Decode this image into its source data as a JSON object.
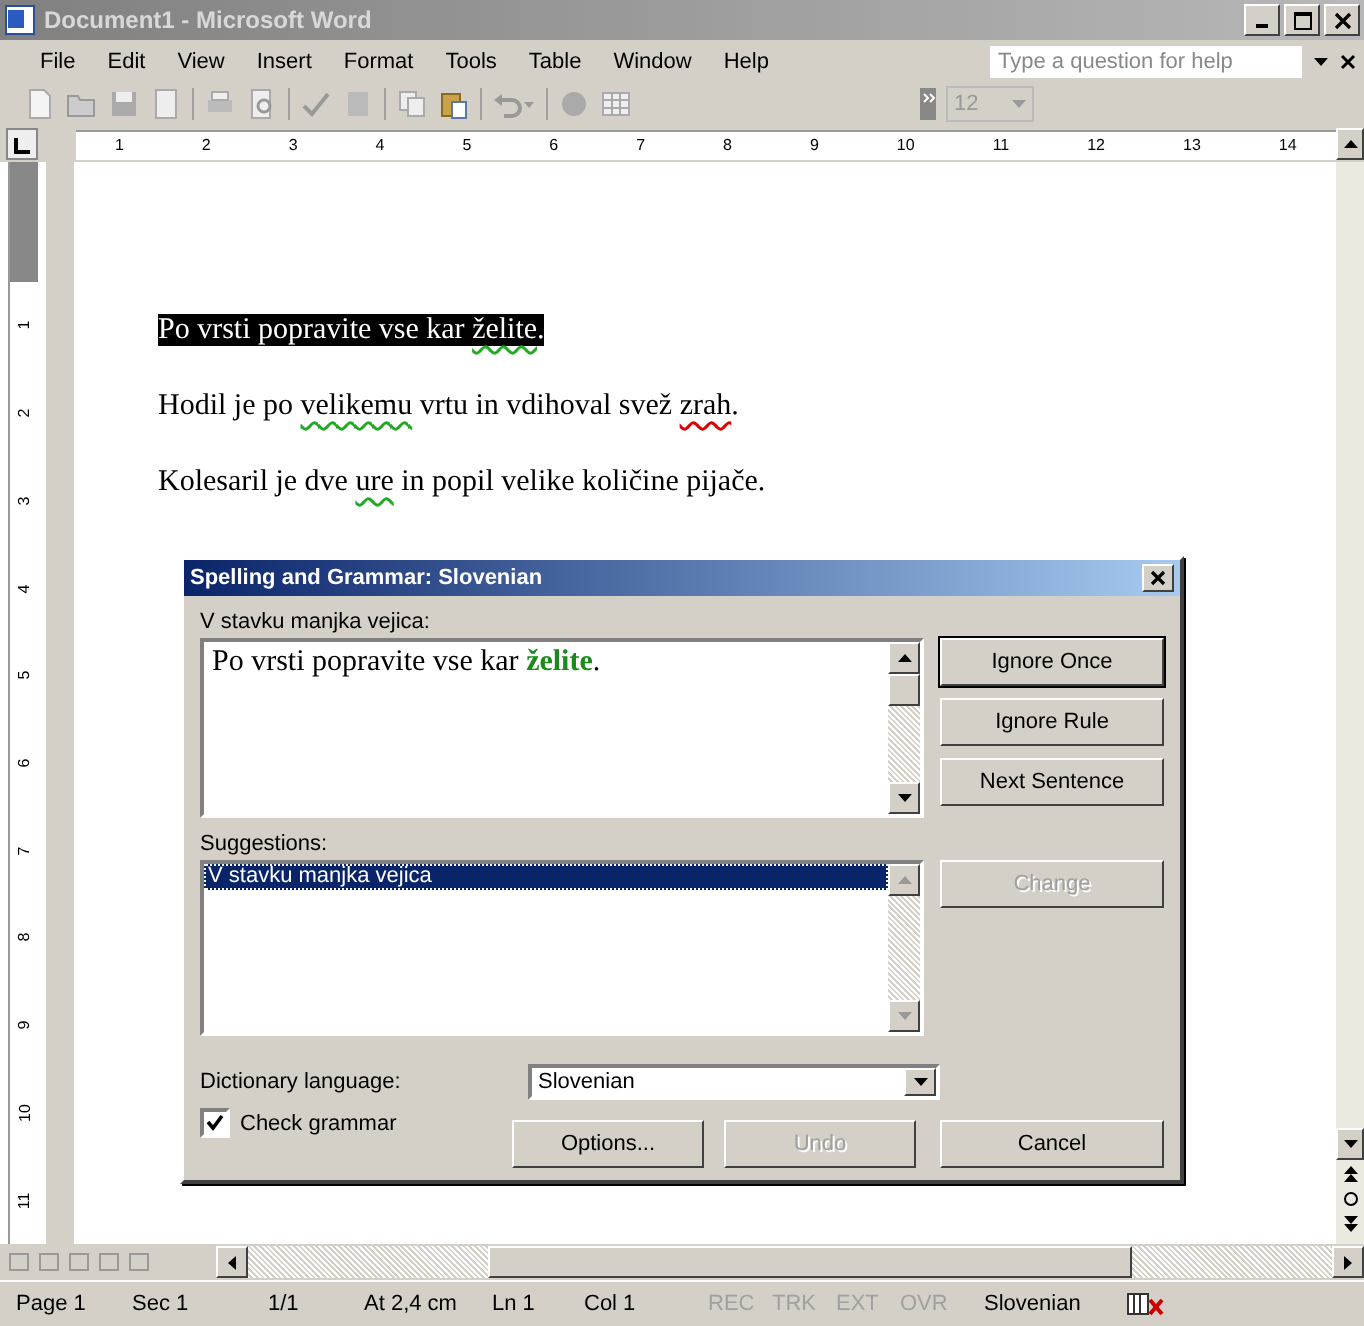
{
  "window": {
    "title": "Document1 - Microsoft Word",
    "active": false
  },
  "menu": [
    "File",
    "Edit",
    "View",
    "Insert",
    "Format",
    "Tools",
    "Table",
    "Window",
    "Help"
  ],
  "help_box": {
    "placeholder": "Type a question for help"
  },
  "toolbar": {
    "font_size": "12"
  },
  "ruler": {
    "marks": [
      "1",
      "2",
      "3",
      "4",
      "5",
      "6",
      "7",
      "8",
      "9",
      "10",
      "11",
      "12",
      "13",
      "14"
    ]
  },
  "vertical_ruler": {
    "marks": [
      "1",
      "2",
      "3",
      "4",
      "5",
      "6",
      "7",
      "8",
      "9",
      "10",
      "11"
    ]
  },
  "document": {
    "paragraphs": [
      {
        "selected": true,
        "segments": [
          {
            "text": "Po vrsti popravite vse kar ",
            "kind": "plain"
          },
          {
            "text": "želite",
            "kind": "grammar"
          },
          {
            "text": ".",
            "kind": "plain"
          }
        ]
      },
      {
        "selected": false,
        "segments": [
          {
            "text": "Hodil je po ",
            "kind": "plain"
          },
          {
            "text": "velikemu",
            "kind": "grammar"
          },
          {
            "text": " vrtu in vdihoval svež ",
            "kind": "plain"
          },
          {
            "text": "zrah",
            "kind": "spelling"
          },
          {
            "text": ".",
            "kind": "plain"
          }
        ]
      },
      {
        "selected": false,
        "segments": [
          {
            "text": "Kolesaril je dve ",
            "kind": "plain"
          },
          {
            "text": "ure",
            "kind": "grammar"
          },
          {
            "text": " in popil velike količine pijače.",
            "kind": "plain"
          }
        ]
      }
    ]
  },
  "dialog": {
    "title": "Spelling and Grammar: Slovenian",
    "sentence_label": "V stavku manjka vejica:",
    "sentence": "Po vrsti popravite vse kar **želite**.",
    "suggestions_label": "Suggestions:",
    "suggestions": [
      {
        "text": "V stavku manjka vejica",
        "selected": true
      }
    ],
    "side_buttons": [
      {
        "label": "Ignore Once",
        "disabled": false
      },
      {
        "label": "Ignore Rule",
        "disabled": false
      },
      {
        "label": "Next Sentence",
        "disabled": false
      },
      {
        "label": "Change",
        "disabled": true
      }
    ],
    "dictionary_label": "Dictionary language:",
    "dictionary_value": "Slovenian",
    "check_grammar": {
      "label": "Check grammar",
      "checked": true
    },
    "bottom_buttons": [
      {
        "label": "Options...",
        "disabled": false
      },
      {
        "label": "Undo",
        "disabled": true
      },
      {
        "label": "Cancel",
        "disabled": false
      }
    ]
  },
  "status_bar": [
    {
      "text": "Page 1",
      "disabled": false
    },
    {
      "text": "Sec 1",
      "disabled": false
    },
    {
      "text": "1/1",
      "disabled": false
    },
    {
      "text": "At 2,4 cm",
      "disabled": false
    },
    {
      "text": "Ln 1",
      "disabled": false
    },
    {
      "text": "Col 1",
      "disabled": false
    },
    {
      "text": "REC",
      "disabled": true
    },
    {
      "text": "TRK",
      "disabled": true
    },
    {
      "text": "EXT",
      "disabled": true
    },
    {
      "text": "OVR",
      "disabled": true
    },
    {
      "text": "Slovenian",
      "disabled": false
    }
  ]
}
